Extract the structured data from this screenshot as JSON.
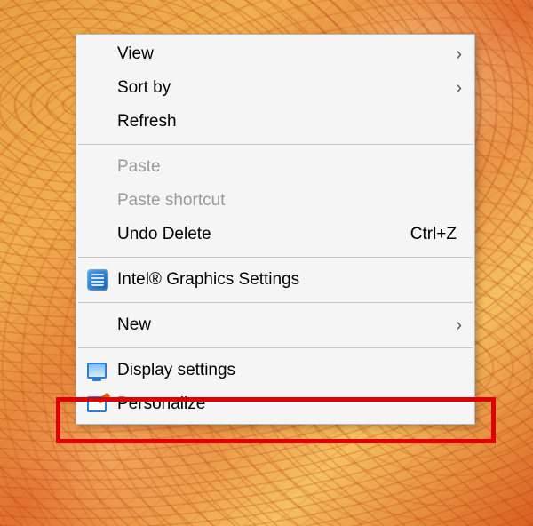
{
  "menu": {
    "view": {
      "label": "View",
      "has_submenu": true
    },
    "sortby": {
      "label": "Sort by",
      "has_submenu": true
    },
    "refresh": {
      "label": "Refresh"
    },
    "paste": {
      "label": "Paste",
      "disabled": true
    },
    "paste_shortcut": {
      "label": "Paste shortcut",
      "disabled": true
    },
    "undo_delete": {
      "label": "Undo Delete",
      "shortcut": "Ctrl+Z"
    },
    "intel_graphics": {
      "label": "Intel® Graphics Settings"
    },
    "new": {
      "label": "New",
      "has_submenu": true
    },
    "display_settings": {
      "label": "Display settings"
    },
    "personalize": {
      "label": "Personalize"
    }
  }
}
